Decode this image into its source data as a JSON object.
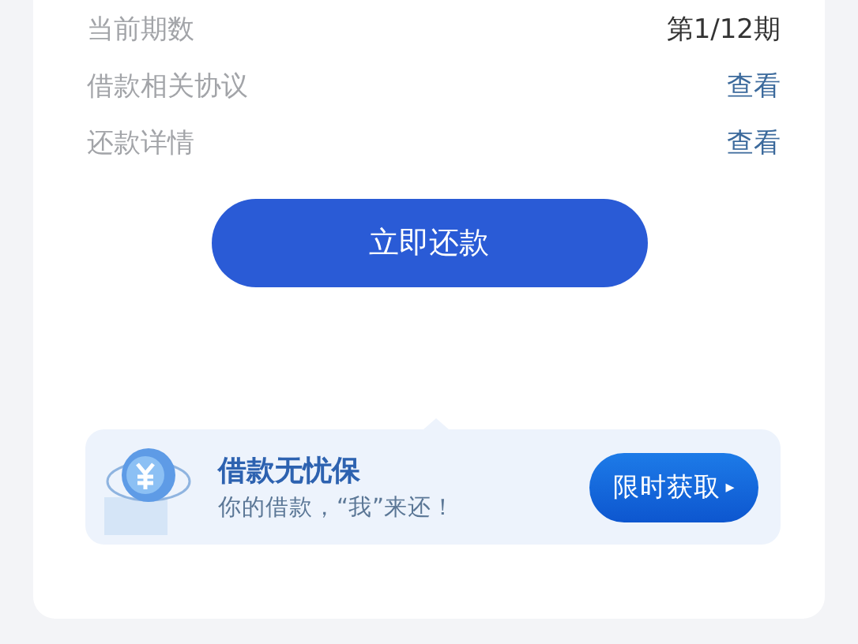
{
  "details": [
    {
      "label": "当前期数",
      "value": "第1/12期",
      "kind": "text"
    },
    {
      "label": "借款相关协议",
      "value": "查看",
      "kind": "link"
    },
    {
      "label": "还款详情",
      "value": "查看",
      "kind": "link"
    }
  ],
  "repay_button": "立即还款",
  "promo": {
    "title": "借款无忧保",
    "subtitle": "你的借款，“我”来还！",
    "button": "限时获取",
    "button_icon": "▸"
  }
}
